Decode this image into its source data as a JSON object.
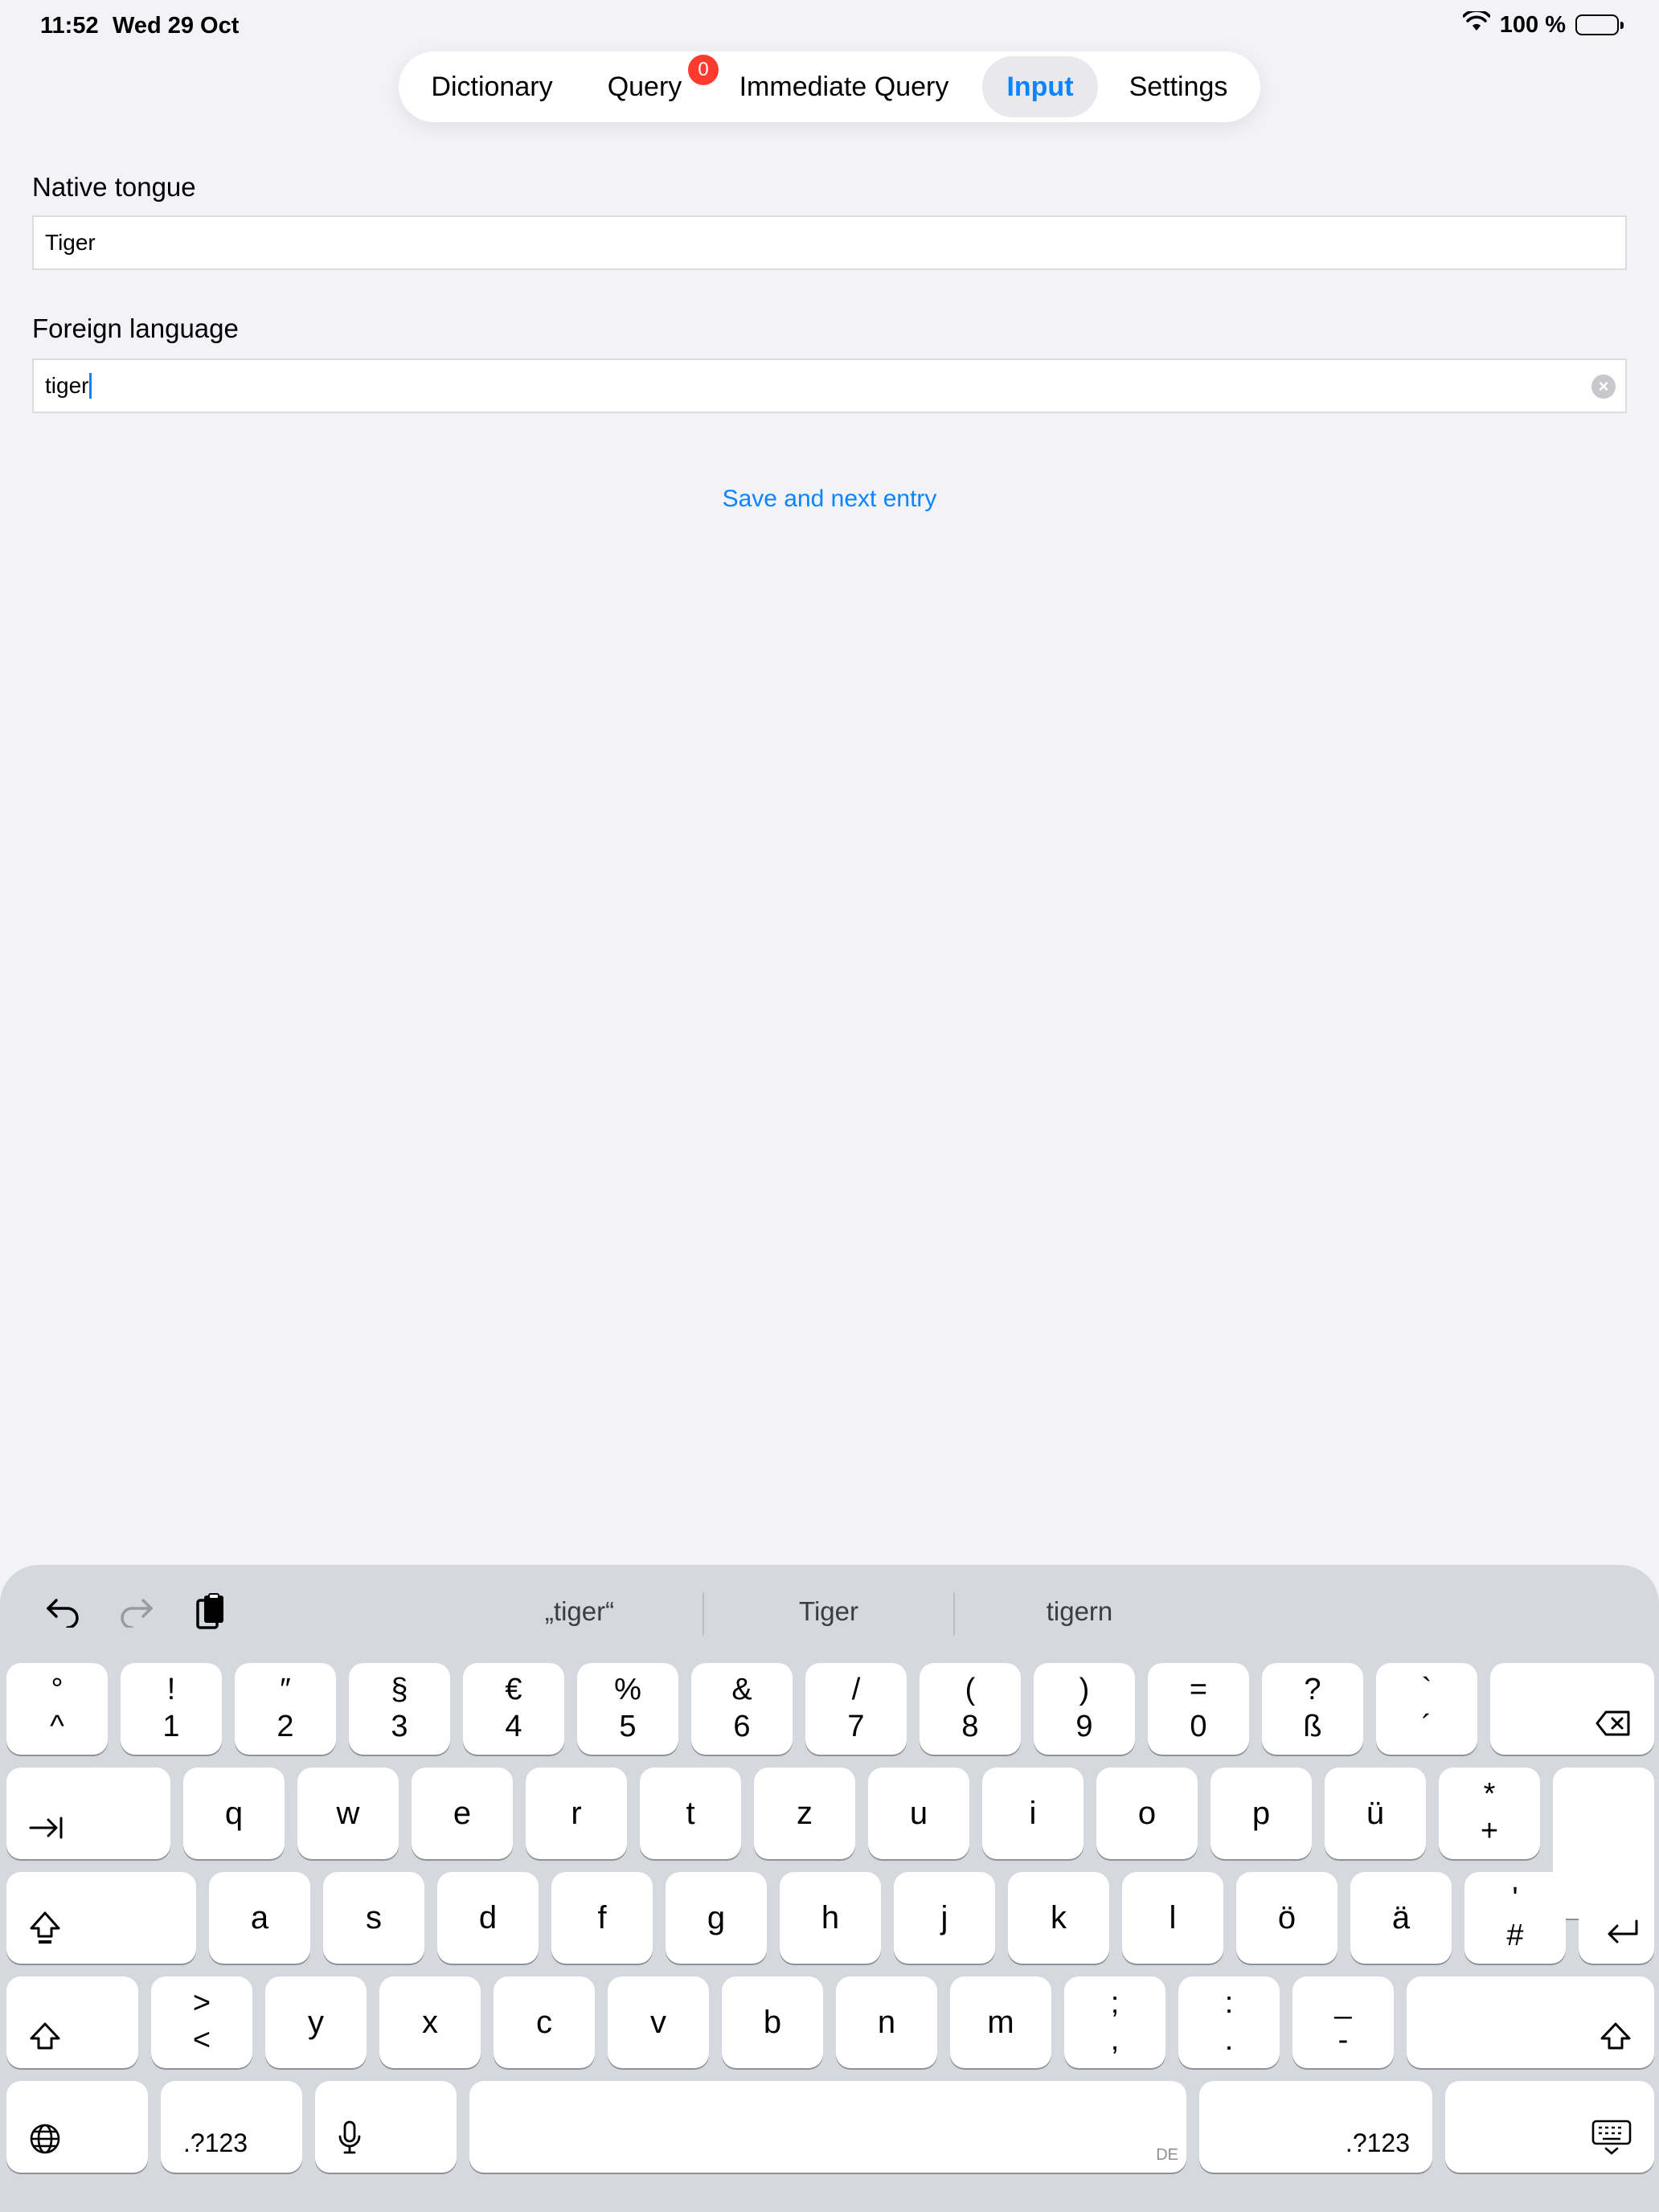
{
  "status_bar": {
    "time": "11:52",
    "date": "Wed 29 Oct",
    "battery": "100 %"
  },
  "tabs": [
    {
      "label": "Dictionary"
    },
    {
      "label": "Query",
      "badge": "0"
    },
    {
      "label": "Immediate Query"
    },
    {
      "label": "Input",
      "active": true
    },
    {
      "label": "Settings"
    }
  ],
  "form": {
    "native_label": "Native tongue",
    "native_value": "Tiger",
    "foreign_label": "Foreign language",
    "foreign_value": "tiger",
    "save_label": "Save and next entry"
  },
  "keyboard": {
    "suggestions": [
      "„tiger“",
      "Tiger",
      "tigern"
    ],
    "row_numbers": [
      {
        "top": "°",
        "bottom": "^"
      },
      {
        "top": "!",
        "bottom": "1"
      },
      {
        "top": "″",
        "bottom": "2"
      },
      {
        "top": "§",
        "bottom": "3"
      },
      {
        "top": "€",
        "bottom": "4"
      },
      {
        "top": "%",
        "bottom": "5"
      },
      {
        "top": "&",
        "bottom": "6"
      },
      {
        "top": "/",
        "bottom": "7"
      },
      {
        "top": "(",
        "bottom": "8"
      },
      {
        "top": ")",
        "bottom": "9"
      },
      {
        "top": "=",
        "bottom": "0"
      },
      {
        "top": "?",
        "bottom": "ß"
      },
      {
        "top": "`",
        "bottom": "´"
      }
    ],
    "row_top": [
      "q",
      "w",
      "e",
      "r",
      "t",
      "z",
      "u",
      "i",
      "o",
      "p",
      "ü"
    ],
    "row_top_last": {
      "top": "*",
      "bottom": "+"
    },
    "row_mid": [
      "a",
      "s",
      "d",
      "f",
      "g",
      "h",
      "j",
      "k",
      "l",
      "ö",
      "ä"
    ],
    "row_mid_last": {
      "top": "'",
      "bottom": "#"
    },
    "row_bottom_first": {
      "top": ">",
      "bottom": "<"
    },
    "row_bottom": [
      "y",
      "x",
      "c",
      "v",
      "b",
      "n",
      "m"
    ],
    "row_bottom_punct": [
      {
        "top": ";",
        "bottom": ","
      },
      {
        "top": ":",
        "bottom": "."
      },
      {
        "top": "_",
        "bottom": "-"
      }
    ],
    "numbers_label": ".?123",
    "space_lang": "DE"
  },
  "colors": {
    "accent": "#0A84FF",
    "badge": "#FF3B30",
    "background": "#F2F2F7",
    "keyboard": "#D5D8DE"
  },
  "icons": [
    "wifi-icon",
    "battery-icon",
    "undo-icon",
    "redo-icon",
    "paste-icon",
    "delete-icon",
    "tab-icon",
    "caps-lock-icon",
    "return-icon",
    "shift-icon",
    "globe-icon",
    "microphone-icon",
    "keyboard-dismiss-icon",
    "clear-icon"
  ]
}
